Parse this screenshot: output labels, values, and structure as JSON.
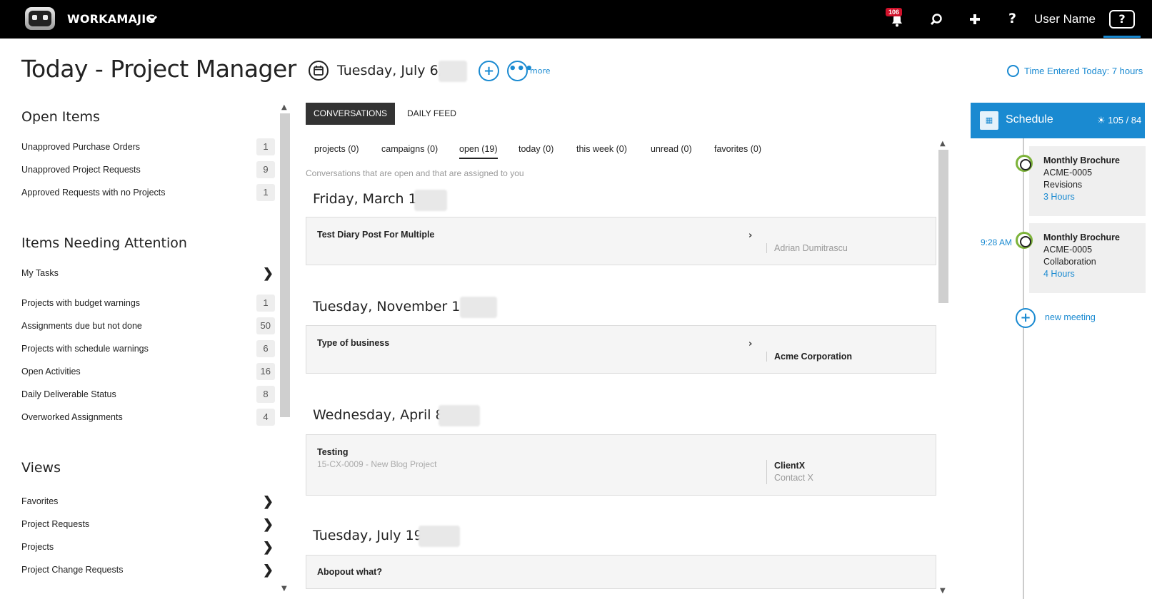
{
  "topbar": {
    "brand": "WORKAMAJIG",
    "notification_count": "106",
    "user_name": "User Name",
    "help_label": "?"
  },
  "header": {
    "page_title": "Today - Project Manager",
    "date": "Tuesday, July 6,",
    "more_label": "more",
    "time_entered": "Time Entered Today: 7 hours"
  },
  "left": {
    "open_items": {
      "title": "Open Items",
      "rows": [
        {
          "label": "Unapproved Purchase Orders",
          "count": "1"
        },
        {
          "label": "Unapproved Project Requests",
          "count": "9"
        },
        {
          "label": "Approved Requests with no Projects",
          "count": "1"
        }
      ]
    },
    "attention": {
      "title": "Items Needing Attention",
      "my_tasks": "My Tasks",
      "rows": [
        {
          "label": "Projects with budget warnings",
          "count": "1"
        },
        {
          "label": "Assignments due but not done",
          "count": "50"
        },
        {
          "label": "Projects with schedule warnings",
          "count": "6"
        },
        {
          "label": "Open Activities",
          "count": "16"
        },
        {
          "label": "Daily Deliverable Status",
          "count": "8"
        },
        {
          "label": "Overworked Assignments",
          "count": "4"
        }
      ]
    },
    "views": {
      "title": "Views",
      "rows": [
        "Favorites",
        "Project Requests",
        "Projects",
        "Project Change Requests"
      ]
    }
  },
  "main": {
    "tabs": [
      "CONVERSATIONS",
      "DAILY FEED"
    ],
    "filters": [
      "projects (0)",
      "campaigns (0)",
      "open (19)",
      "today (0)",
      "this week (0)",
      "unread (0)",
      "favorites (0)"
    ],
    "hint": "Conversations that are open and that are assigned to you",
    "days": [
      {
        "date": "Friday, March 1,",
        "title": "Test Diary Post For Multiple",
        "sub": "",
        "right": "Adrian Dumitrascu",
        "right_sub": ""
      },
      {
        "date": "Tuesday, November 11,",
        "title": "Type of business",
        "sub": "",
        "right": "Acme Corporation",
        "right_sub": ""
      },
      {
        "date": "Wednesday, April 8,",
        "title": "Testing",
        "sub": "15-CX-0009 - New Blog Project",
        "right": "ClientX",
        "right_sub": "Contact X"
      },
      {
        "date": "Tuesday, July 19,",
        "title": "Abopout what?",
        "sub": "",
        "right": "",
        "right_sub": ""
      }
    ]
  },
  "schedule": {
    "title": "Schedule",
    "count": "105 / 84",
    "items": [
      {
        "title": "Monthly Brochure",
        "code": "ACME-0005",
        "task": "Revisions",
        "hours": "3 Hours",
        "time": ""
      },
      {
        "title": "Monthly Brochure",
        "code": "ACME-0005",
        "task": "Collaboration",
        "hours": "4 Hours",
        "time": "9:28 AM"
      }
    ],
    "new_meeting": "new meeting"
  },
  "colors": {
    "accent": "#1a8ad1",
    "topbar": "#000000",
    "badge": "#d0122b",
    "schedule_ring": "#7db33a"
  }
}
